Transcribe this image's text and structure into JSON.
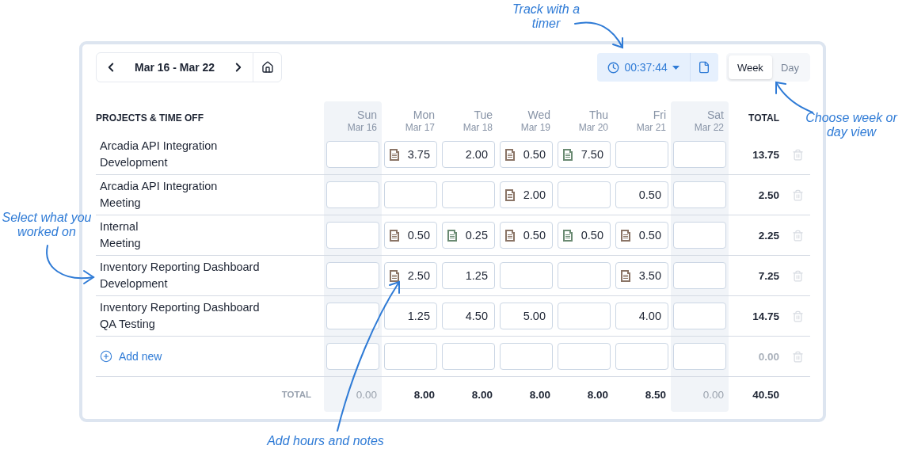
{
  "annotations": [
    {
      "text": "Track with a timer"
    },
    {
      "text": "Choose week or day view"
    },
    {
      "text": "Select what you worked on"
    },
    {
      "text": "Add hours and notes"
    }
  ],
  "toolbar": {
    "date_range": "Mar 16 - Mar 22",
    "timer": "00:37:44",
    "view_toggle": [
      {
        "label": "Week",
        "selected": true
      },
      {
        "label": "Day",
        "selected": false
      }
    ]
  },
  "table": {
    "header": "PROJECTS & TIME OFF",
    "total_header": "TOTAL",
    "days": [
      {
        "day": "Sun",
        "date": "Mar 16",
        "weekend": true
      },
      {
        "day": "Mon",
        "date": "Mar 17",
        "weekend": false
      },
      {
        "day": "Tue",
        "date": "Mar 18",
        "weekend": false
      },
      {
        "day": "Wed",
        "date": "Mar 19",
        "weekend": false
      },
      {
        "day": "Thu",
        "date": "Mar 20",
        "weekend": false
      },
      {
        "day": "Fri",
        "date": "Mar 21",
        "weekend": false
      },
      {
        "day": "Sat",
        "date": "Mar 22",
        "weekend": true
      }
    ],
    "rows": [
      {
        "project": "Arcadia API Integration",
        "task": "Development",
        "total": "13.75",
        "cells": [
          {},
          {
            "hours": "3.75",
            "color": "#8a7466"
          },
          {
            "hours": "2.00"
          },
          {
            "hours": "0.50",
            "color": "#8a7466"
          },
          {
            "hours": "7.50",
            "color": "#6a8a72"
          },
          {},
          {}
        ]
      },
      {
        "project": "Arcadia API Integration",
        "task": "Meeting",
        "total": "2.50",
        "cells": [
          {},
          {},
          {},
          {
            "hours": "2.00",
            "color": "#8a7466"
          },
          {},
          {
            "hours": "0.50"
          },
          {}
        ]
      },
      {
        "project": "Internal",
        "task": "Meeting",
        "total": "2.25",
        "cells": [
          {},
          {
            "hours": "0.50",
            "color": "#8a7466"
          },
          {
            "hours": "0.25",
            "color": "#6a8a72"
          },
          {
            "hours": "0.50",
            "color": "#8a7466"
          },
          {
            "hours": "0.50",
            "color": "#6a8a72"
          },
          {
            "hours": "0.50",
            "color": "#8a7466"
          },
          {}
        ]
      },
      {
        "project": "Inventory Reporting Dashboard",
        "task": "Development",
        "total": "7.25",
        "cells": [
          {},
          {
            "hours": "2.50",
            "color": "#8a7466"
          },
          {
            "hours": "1.25"
          },
          {},
          {},
          {
            "hours": "3.50",
            "color": "#8a7466"
          },
          {}
        ]
      },
      {
        "project": "Inventory Reporting Dashboard",
        "task": "QA Testing",
        "total": "14.75",
        "cells": [
          {},
          {
            "hours": "1.25"
          },
          {
            "hours": "4.50"
          },
          {
            "hours": "5.00"
          },
          {},
          {
            "hours": "4.00"
          },
          {}
        ]
      }
    ],
    "add_new": {
      "label": "Add new",
      "total": "0.00"
    },
    "totals": {
      "label": "TOTAL",
      "values": [
        "0.00",
        "8.00",
        "8.00",
        "8.00",
        "8.00",
        "8.50",
        "0.00"
      ],
      "grand": "40.50"
    }
  }
}
